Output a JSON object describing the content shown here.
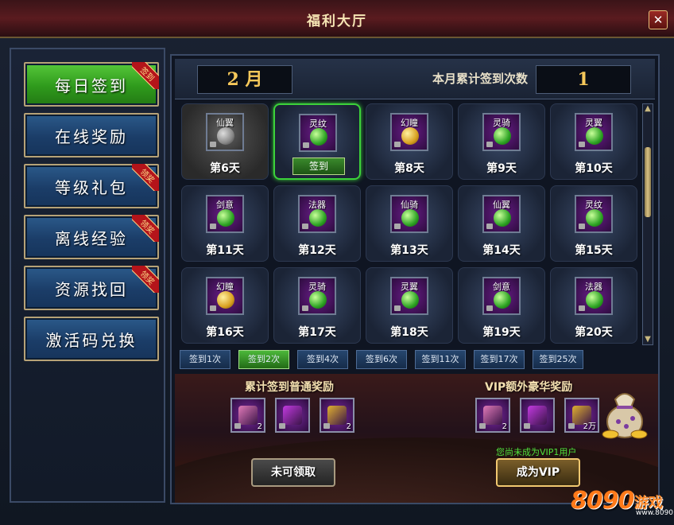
{
  "window": {
    "title": "福利大厅",
    "close_glyph": "✕"
  },
  "sidebar": {
    "items": [
      {
        "label": "每日签到",
        "badge": "签到",
        "active": true
      },
      {
        "label": "在线奖励",
        "badge": "",
        "active": false
      },
      {
        "label": "等级礼包",
        "badge": "领奖",
        "active": false
      },
      {
        "label": "离线经验",
        "badge": "领奖",
        "active": false
      },
      {
        "label": "资源找回",
        "badge": "领奖",
        "active": false
      },
      {
        "label": "激活码兑换",
        "badge": "",
        "active": false
      }
    ]
  },
  "header": {
    "month": "2 月",
    "count_label": "本月累计签到次数",
    "count_value": "1"
  },
  "calendar": {
    "sign_button_label": "签到",
    "cells": [
      {
        "tag": "仙翼",
        "day": "第6天",
        "state": "past",
        "gem": "grey"
      },
      {
        "tag": "灵纹",
        "day": "",
        "state": "today",
        "gem": "green"
      },
      {
        "tag": "幻瞳",
        "day": "第8天",
        "state": "future",
        "gem": "gold"
      },
      {
        "tag": "灵骑",
        "day": "第9天",
        "state": "future",
        "gem": "green"
      },
      {
        "tag": "灵翼",
        "day": "第10天",
        "state": "future",
        "gem": "green"
      },
      {
        "tag": "剑意",
        "day": "第11天",
        "state": "future",
        "gem": "green"
      },
      {
        "tag": "法器",
        "day": "第12天",
        "state": "future",
        "gem": "green"
      },
      {
        "tag": "仙骑",
        "day": "第13天",
        "state": "future",
        "gem": "green"
      },
      {
        "tag": "仙翼",
        "day": "第14天",
        "state": "future",
        "gem": "green"
      },
      {
        "tag": "灵纹",
        "day": "第15天",
        "state": "future",
        "gem": "green"
      },
      {
        "tag": "幻瞳",
        "day": "第16天",
        "state": "future",
        "gem": "gold"
      },
      {
        "tag": "灵骑",
        "day": "第17天",
        "state": "future",
        "gem": "green"
      },
      {
        "tag": "灵翼",
        "day": "第18天",
        "state": "future",
        "gem": "green"
      },
      {
        "tag": "剑意",
        "day": "第19天",
        "state": "future",
        "gem": "green"
      },
      {
        "tag": "法器",
        "day": "第20天",
        "state": "future",
        "gem": "green"
      }
    ]
  },
  "tabs": [
    {
      "label": "签到1次",
      "active": false
    },
    {
      "label": "签到2次",
      "active": true
    },
    {
      "label": "签到4次",
      "active": false
    },
    {
      "label": "签到6次",
      "active": false
    },
    {
      "label": "签到11次",
      "active": false
    },
    {
      "label": "签到17次",
      "active": false
    },
    {
      "label": "签到25次",
      "active": false
    }
  ],
  "rewards": {
    "normal_title": "累计签到普通奖励",
    "vip_title": "VIP额外豪华奖励",
    "normal_items": [
      {
        "name": "feather-item",
        "qty": "2",
        "color": "#e07ab8"
      },
      {
        "name": "potion-item",
        "qty": "",
        "color": "#c23ae0"
      },
      {
        "name": "scroll-item",
        "qty": "2",
        "color": "#e0b030"
      }
    ],
    "vip_items": [
      {
        "name": "feather-item",
        "qty": "2",
        "color": "#e07ab8"
      },
      {
        "name": "potion-item",
        "qty": "",
        "color": "#c23ae0"
      },
      {
        "name": "coins-item",
        "qty": "2万",
        "color": "#e0b030"
      }
    ],
    "vip_note": "您尚未成为VIP1用户",
    "claim_label": "未可领取",
    "vip_button_label": "成为VIP"
  },
  "watermark": {
    "num": "8090",
    "cn": "游戏",
    "url": "www.8090.com"
  },
  "colors": {
    "accent_gold": "#f6c85a",
    "active_green": "#3cd23a",
    "tab_blue": "#26466e"
  }
}
